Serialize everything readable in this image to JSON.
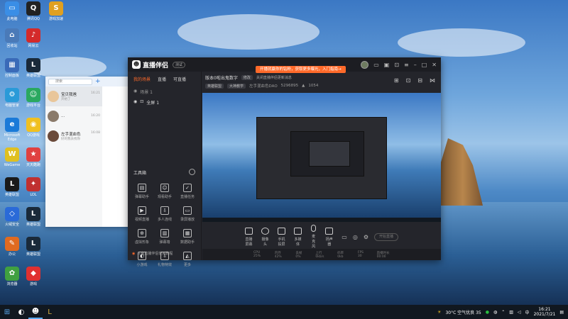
{
  "desktop": {
    "icons": [
      {
        "label": "此电脑",
        "color": "#3a8ee6",
        "glyph": "▭"
      },
      {
        "label": "腾讯QQ",
        "color": "#222",
        "glyph": "Q"
      },
      {
        "label": "游戏加速",
        "color": "#e0a020",
        "glyph": "S"
      },
      {
        "label": "回收站",
        "color": "#4a7ab8",
        "glyph": "⌂"
      },
      {
        "label": "网易云",
        "color": "#d42a2a",
        "glyph": "♪"
      },
      {
        "label": "控制面板",
        "color": "#3a6ab8",
        "glyph": "▦"
      },
      {
        "label": "英雄联盟",
        "color": "#1a2a3a",
        "glyph": "L"
      },
      {
        "label": "电脑管家",
        "color": "#2a9ad8",
        "glyph": "⚙"
      },
      {
        "label": "游戏平台",
        "color": "#2aa860",
        "glyph": "☺"
      },
      {
        "label": "Microsoft Edge",
        "color": "#1a7ad8",
        "glyph": "e"
      },
      {
        "label": "QQ游戏",
        "color": "#f0c020",
        "glyph": "◉"
      },
      {
        "label": "WeGame",
        "color": "#e0c020",
        "glyph": "W"
      },
      {
        "label": "天天酷跑",
        "color": "#e04040",
        "glyph": "★"
      },
      {
        "label": "英雄联盟",
        "color": "#1a1a1a",
        "glyph": "L"
      },
      {
        "label": "LOL",
        "color": "#c03030",
        "glyph": "✦"
      },
      {
        "label": "火绒安全",
        "color": "#2a6ad8",
        "glyph": "◇"
      },
      {
        "label": "英雄联盟",
        "color": "#1a2a3a",
        "glyph": "L"
      },
      {
        "label": "办公",
        "color": "#e06a20",
        "glyph": "✎"
      },
      {
        "label": "英雄联盟",
        "color": "#1a2a3a",
        "glyph": "L"
      },
      {
        "label": "浏览器",
        "color": "#40a040",
        "glyph": "✿"
      },
      {
        "label": "游戏",
        "color": "#e03030",
        "glyph": "◆"
      }
    ]
  },
  "qq": {
    "search_placeholder": "搜索",
    "contacts": [
      {
        "name": "宝贝我爸",
        "time": "16:21",
        "msg": "开始了",
        "color": "#e9c69a"
      },
      {
        "name": "...",
        "time": "16:20",
        "msg": "",
        "color": "#8a7a6a"
      },
      {
        "name": "左手混血色",
        "time": "16:08",
        "msg": "好的我去找你",
        "color": "#6a4a3a"
      }
    ],
    "chat_snippets": [
      "左",
      "好"
    ]
  },
  "app": {
    "logo_text": "直播伴侣",
    "version_badge": "测试",
    "promo": "开播就赢你的钻粉，获取更多曝光，入门指南→",
    "left_tabs": [
      "我的场景",
      "直播",
      "可直播"
    ],
    "scene_header": "场景 1",
    "scenes": [
      "全屏 1"
    ],
    "toolbox_title": "工具箱",
    "tools": [
      {
        "label": "弹幕助手",
        "glyph": "▤"
      },
      {
        "label": "观看助手",
        "glyph": "☺"
      },
      {
        "label": "直播任务",
        "glyph": "✓"
      },
      {
        "label": "视频直播",
        "glyph": "▶"
      },
      {
        "label": "多人连线",
        "glyph": "⇩"
      },
      {
        "label": "录屏播放",
        "glyph": "▭"
      },
      {
        "label": "虚拟形象",
        "glyph": "⊕"
      },
      {
        "label": "弹幕墙",
        "glyph": "▥"
      },
      {
        "label": "数据助手",
        "glyph": "▦"
      },
      {
        "label": "小游戏",
        "glyph": "◐"
      },
      {
        "label": "礼物特效",
        "glyph": "⇩"
      },
      {
        "label": "更多",
        "glyph": "◭"
      }
    ],
    "notice": "斗鱼直播伴侣使用教程",
    "room_title": "版本0啦出鬼数字",
    "room_edit": "修改",
    "room_notice": "关闭直播伴侣更新消息",
    "room_category": "英雄联盟",
    "room_tag": "大神教学",
    "room_owner": "左手混血色DAO",
    "room_id": "5296895",
    "room_fans": "1054",
    "bottom_items": [
      "直播屏幕",
      "摄像头",
      "手机投屏",
      "多媒体",
      "麦克风",
      "扬声器"
    ],
    "start_label": "开始直播",
    "status_items": [
      "CPU 25%",
      "内存 42%",
      "丢帧 0%",
      "上行 0kb/s",
      "码率 0kb",
      "FPS 30",
      "直播时长 00:00"
    ]
  },
  "taskbar": {
    "weather": "30°C 空气优良 35",
    "time": "16:21",
    "date": "2021/7/21"
  }
}
